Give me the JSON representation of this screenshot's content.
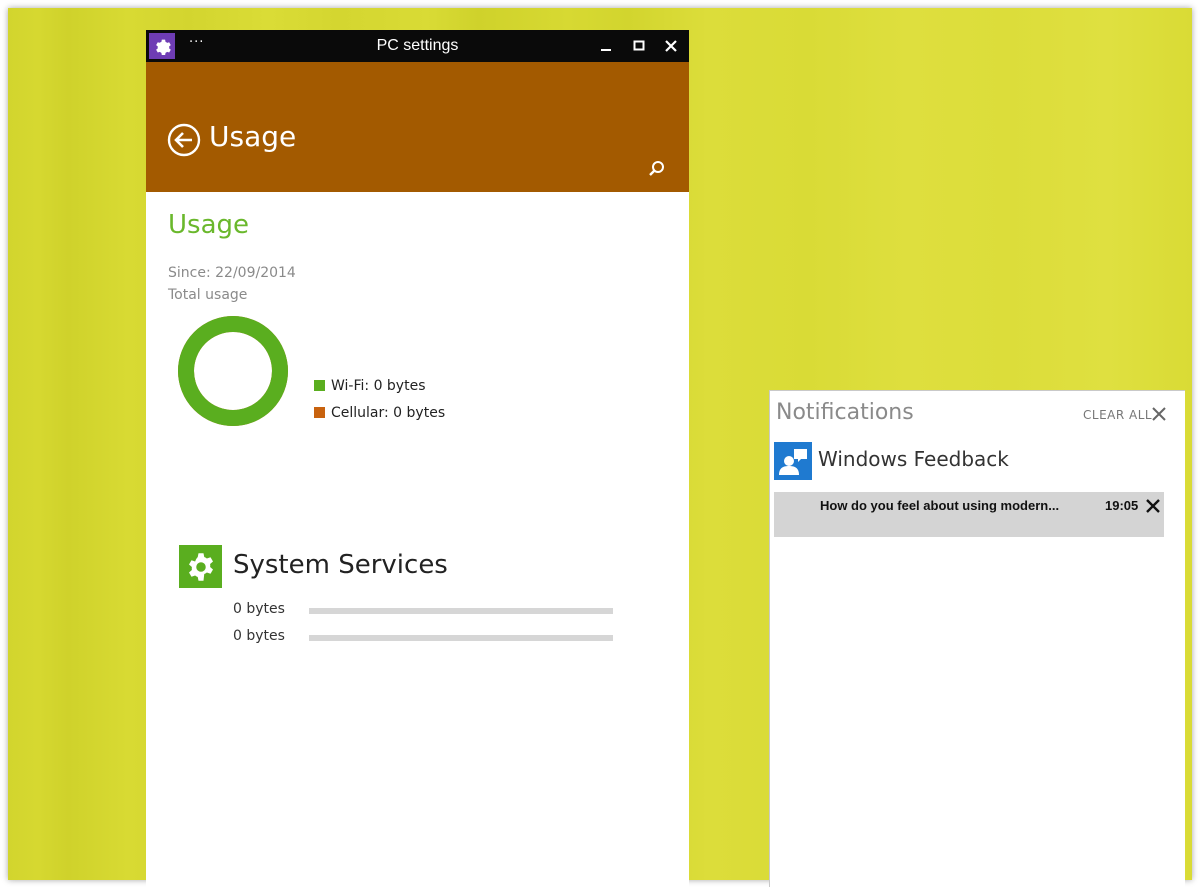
{
  "window": {
    "title": "PC settings",
    "menu_label": "···",
    "header_title": "Usage"
  },
  "usage": {
    "title": "Usage",
    "since": "Since: 22/09/2014",
    "total_label": "Total usage",
    "wifi_fraction": 1.0,
    "legend": [
      {
        "label": "Wi-Fi: 0 bytes",
        "color": "#5aae1f"
      },
      {
        "label": "Cellular: 0 bytes",
        "color": "#c8620e"
      }
    ]
  },
  "system_services": {
    "title": "System Services",
    "rows": [
      {
        "label": "0 bytes",
        "fraction": 0
      },
      {
        "label": "0 bytes",
        "fraction": 0
      }
    ]
  },
  "notifications": {
    "title": "Notifications",
    "clear_all": "CLEAR ALL",
    "app_name": "Windows Feedback",
    "items": [
      {
        "text": "How do you feel about using modern...",
        "time": "19:05"
      }
    ]
  },
  "colors": {
    "accent_green": "#6ab82c",
    "header_orange": "#a35a00",
    "wallpaper": "#d6d832"
  }
}
